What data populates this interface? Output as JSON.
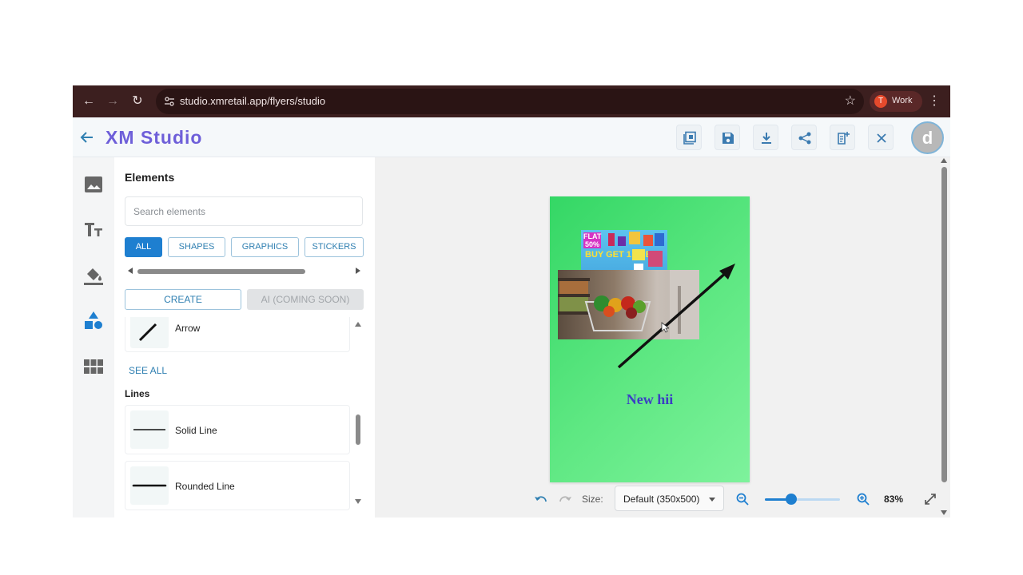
{
  "browser": {
    "url": "studio.xmretail.app/flyers/studio",
    "profile_initial": "T",
    "profile_label": "Work",
    "icons": [
      "back-arrow-icon",
      "forward-arrow-icon",
      "reload-icon",
      "site-settings-icon",
      "bookmark-star-icon",
      "more-vertical-icon"
    ]
  },
  "header": {
    "title": "XM Studio",
    "avatar_initial": "d",
    "accent_color": "#6e5fd9",
    "tools": [
      "templates-icon",
      "save-icon",
      "download-icon",
      "share-icon",
      "add-page-icon",
      "close-icon"
    ]
  },
  "rail": {
    "items": [
      "image-icon",
      "text-icon",
      "fill-bucket-icon",
      "shapes-icon",
      "grid-icon"
    ],
    "active_color": "#1e7fd0"
  },
  "panel": {
    "title": "Elements",
    "search_placeholder": "Search elements",
    "tabs": [
      {
        "label": "ALL",
        "active": true
      },
      {
        "label": "SHAPES",
        "active": false
      },
      {
        "label": "GRAPHICS",
        "active": false
      },
      {
        "label": "STICKERS",
        "active": false
      }
    ],
    "create_label": "CREATE",
    "ai_label": "AI (COMING SOON)",
    "arrow_item": "Arrow",
    "see_all": "SEE ALL",
    "lines_heading": "Lines",
    "lines": [
      "Solid Line",
      "Rounded Line"
    ]
  },
  "canvas": {
    "flyer_text": "New hii",
    "promo_badge": "FLAT 50%",
    "promo_text": "BUY GET 1 FREE",
    "flyer_gradient": [
      "#34d765",
      "#7ef29c"
    ],
    "text_color": "#3b3fc4"
  },
  "bottom": {
    "size_label": "Size:",
    "size_value": "Default (350x500)",
    "zoom_value": "83%",
    "zoom_fraction": 0.35
  }
}
